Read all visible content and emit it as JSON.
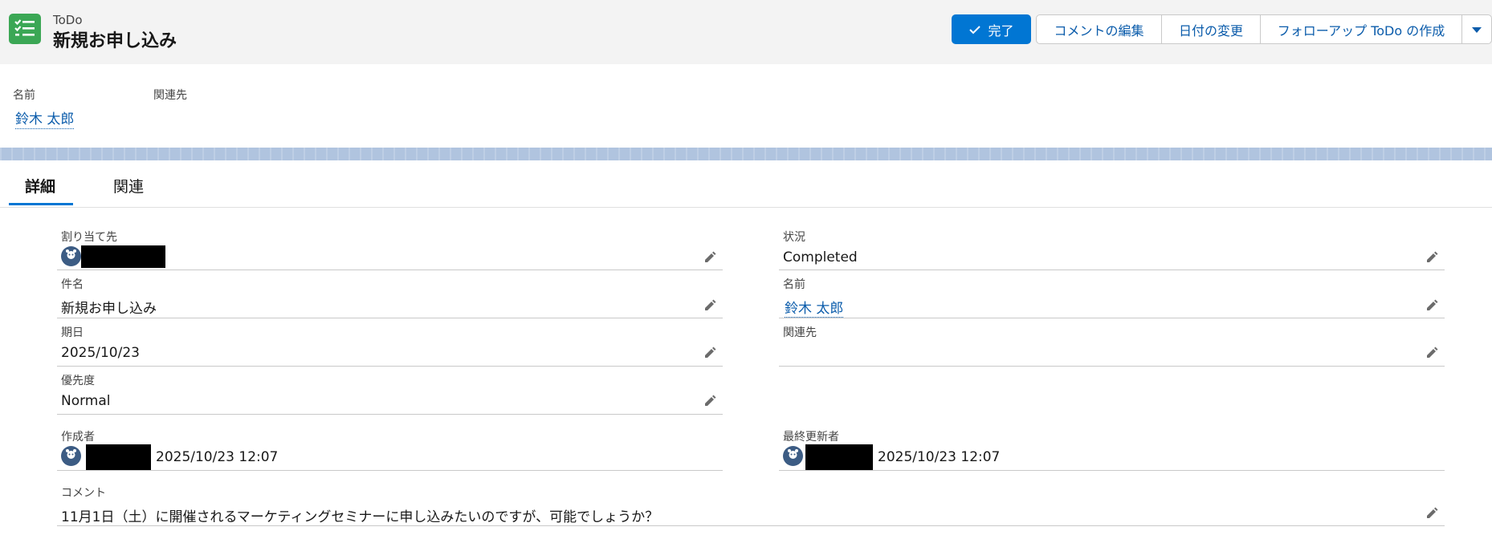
{
  "header": {
    "object_type": "ToDo",
    "title": "新規お申し込み",
    "icon": "task-checklist-icon",
    "actions": {
      "complete": "完了",
      "edit_comment": "コメントの編集",
      "change_date": "日付の変更",
      "create_followup": "フォローアップ ToDo の作成"
    }
  },
  "highlights": {
    "name_label": "名前",
    "name_value": "鈴木 太郎",
    "related_label": "関連先"
  },
  "tabs": {
    "details": "詳細",
    "related": "関連"
  },
  "fields": {
    "assigned_to_label": "割り当て先",
    "status_label": "状況",
    "status_value": "Completed",
    "subject_label": "件名",
    "subject_value": "新規お申し込み",
    "name_label": "名前",
    "name_value": "鈴木 太郎",
    "due_date_label": "期日",
    "due_date_value": "2025/10/23",
    "related_label": "関連先",
    "priority_label": "優先度",
    "priority_value": "Normal",
    "created_by_label": "作成者",
    "created_by_time": "2025/10/23 12:07",
    "last_modified_label": "最終更新者",
    "last_modified_time": "2025/10/23 12:07",
    "comment_label": "コメント",
    "comment_value": "11月1日（土）に開催されるマーケティングセミナーに申し込みたいのですが、可能でしょうか？"
  },
  "colors": {
    "brand": "#0176d3",
    "link": "#0b5cab",
    "icon_green": "#3ba755"
  }
}
